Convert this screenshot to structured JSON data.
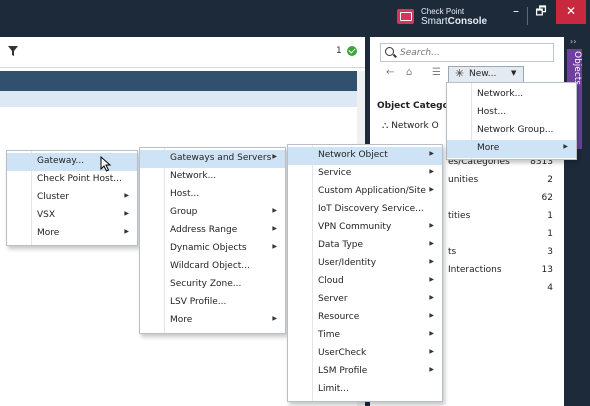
{
  "app": {
    "logo_line1": "Check Point",
    "logo_line2_a": "Smart",
    "logo_line2_b": "Console",
    "accent": "#1d2a3a",
    "close_color": "#c8293e"
  },
  "window": {
    "min": "–",
    "max": "🗗",
    "close": "✕"
  },
  "main": {
    "count": "1"
  },
  "right_panel": {
    "search_placeholder": "Search...",
    "new_label": "New...",
    "category_title": "Object Catego",
    "network_row": "Network O",
    "rows": [
      {
        "text": "es/Categories",
        "count": "8313"
      },
      {
        "text": "unities",
        "count": "2"
      },
      {
        "text": "",
        "count": "62"
      },
      {
        "text": "tities",
        "count": "1"
      },
      {
        "text": "",
        "count": "1"
      },
      {
        "text": "ts",
        "count": "3"
      },
      {
        "text": "Interactions",
        "count": "13"
      },
      {
        "text": "",
        "count": "4"
      }
    ],
    "vertical_tab": "Objects"
  },
  "new_menu": {
    "items": [
      "Network...",
      "Host...",
      "Network Group...",
      "More"
    ]
  },
  "menu1": {
    "items": [
      "Gateway...",
      "Check Point Host...",
      "Cluster",
      "VSX",
      "More"
    ]
  },
  "menu2": {
    "items": [
      "Gateways and Servers",
      "Network...",
      "Host...",
      "Group",
      "Address Range",
      "Dynamic Objects",
      "Wildcard Object...",
      "Security Zone...",
      "LSV Profile...",
      "More"
    ]
  },
  "menu3": {
    "items": [
      "Network Object",
      "Service",
      "Custom Application/Site",
      "IoT Discovery Service...",
      "VPN Community",
      "Data Type",
      "User/Identity",
      "Cloud",
      "Server",
      "Resource",
      "Time",
      "UserCheck",
      "LSM Profile",
      "Limit..."
    ]
  }
}
